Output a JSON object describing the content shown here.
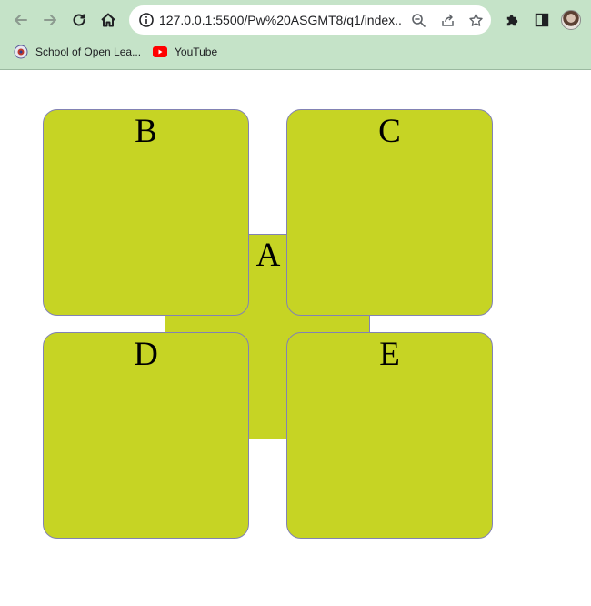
{
  "browser": {
    "url": "127.0.0.1:5500/Pw%20ASGMT8/q1/index....",
    "bookmarks": [
      {
        "label": "School of Open Lea..."
      },
      {
        "label": "YouTube"
      }
    ]
  },
  "page": {
    "boxes": {
      "a": "A",
      "b": "B",
      "c": "C",
      "d": "D",
      "e": "E"
    }
  },
  "colors": {
    "box_fill": "#c6d424",
    "box_border": "#8282b4",
    "chrome_bg": "#c5e3c8"
  }
}
